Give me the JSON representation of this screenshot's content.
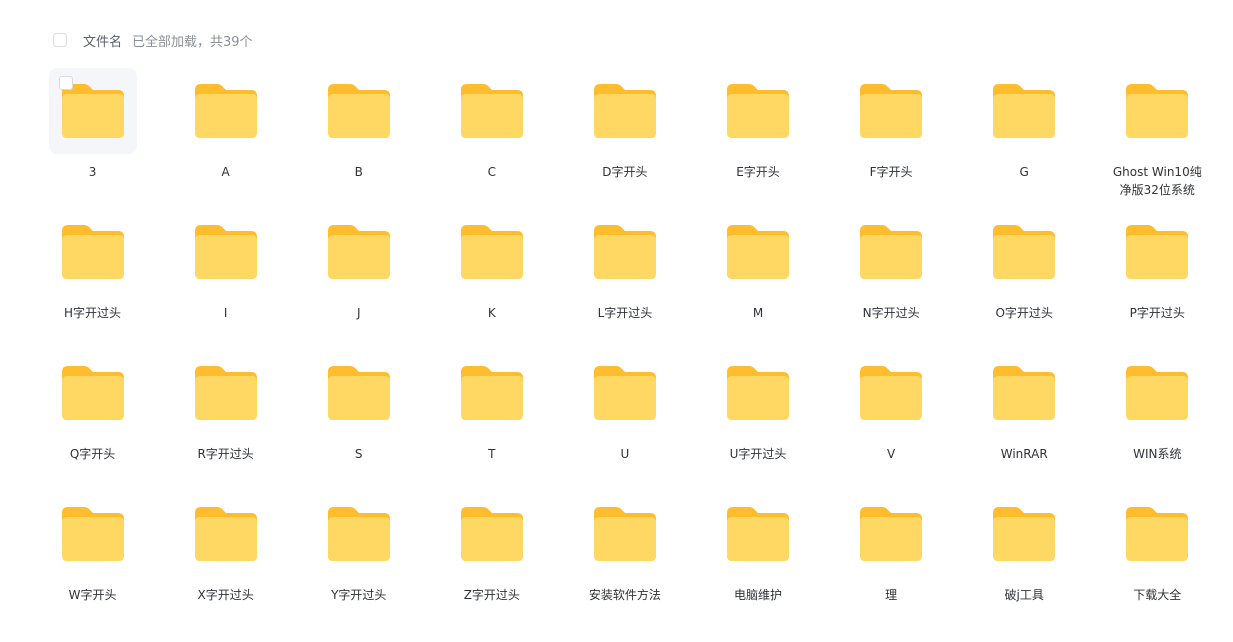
{
  "header": {
    "title": "文件名",
    "count": "已全部加载，共39个"
  },
  "folder_icon": "folder-icon",
  "colors": {
    "folder_back": "#FFBC2C",
    "folder_front": "#FFD863",
    "hover_bg": "#f4f6fa"
  },
  "folders": [
    "3",
    "A",
    "B",
    "C",
    "D字开头",
    "E字开头",
    "F字开头",
    "G",
    "Ghost Win10纯净版32位系统",
    "H字开过头",
    "I",
    "J",
    "K",
    "L字开过头",
    "M",
    "N字开过头",
    "O字开过头",
    "P字开过头",
    "Q字开头",
    "R字开过头",
    "S",
    "T",
    "U",
    "U字开过头",
    "V",
    "WinRAR",
    "WIN系统",
    "W字开头",
    "X字开过头",
    "Y字开过头",
    "Z字开过头",
    "安装软件方法",
    "电脑维护",
    "理",
    "破j工具",
    "下载大全"
  ]
}
